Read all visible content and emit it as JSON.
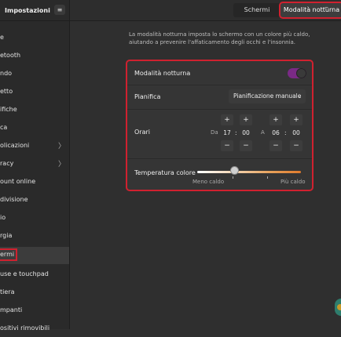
{
  "header": {
    "app_title": "Impostazioni",
    "menu_icon": "hamburger-menu-icon",
    "tabs": [
      {
        "label": "Schermi"
      },
      {
        "label": "Modalità notturna"
      }
    ],
    "minimize_label": "–"
  },
  "sidebar": {
    "items": [
      {
        "label": "e"
      },
      {
        "label": "etooth"
      },
      {
        "label": "ndo"
      },
      {
        "label": "etto"
      },
      {
        "label": "ifiche"
      },
      {
        "label": "ca"
      },
      {
        "label": "olicazioni",
        "chevron": "〉"
      },
      {
        "label": "racy",
        "chevron": "〉"
      },
      {
        "label": "ount online"
      },
      {
        "label": "divisione"
      },
      {
        "label": "io"
      },
      {
        "label": "rgia"
      },
      {
        "label": "ermi"
      },
      {
        "label": "use e touchpad"
      },
      {
        "label": "tiera"
      },
      {
        "label": "mpanti"
      },
      {
        "label": "ositivi rimovibili"
      }
    ]
  },
  "main": {
    "description": "La modalità notturna imposta lo schermo con un colore più caldo, aiutando a prevenire l'affaticamento degli occhi e l'insonnia.",
    "night_mode": {
      "label": "Modalità notturna",
      "enabled": true,
      "accent": "#7a2a86"
    },
    "schedule": {
      "label": "Pianifica",
      "value": "Pianificazione manuale",
      "chevron": "⌄"
    },
    "times": {
      "label": "Orari",
      "from_label": "Da",
      "to_label": "A",
      "from_hours": "17",
      "from_minutes": "00",
      "to_hours": "06",
      "to_minutes": "00",
      "colon": ":",
      "plus": "+",
      "minus": "−"
    },
    "temperature": {
      "label": "Temperatura colore",
      "min_label": "Meno caldo",
      "max_label": "Più caldo",
      "level": 0.33
    }
  }
}
